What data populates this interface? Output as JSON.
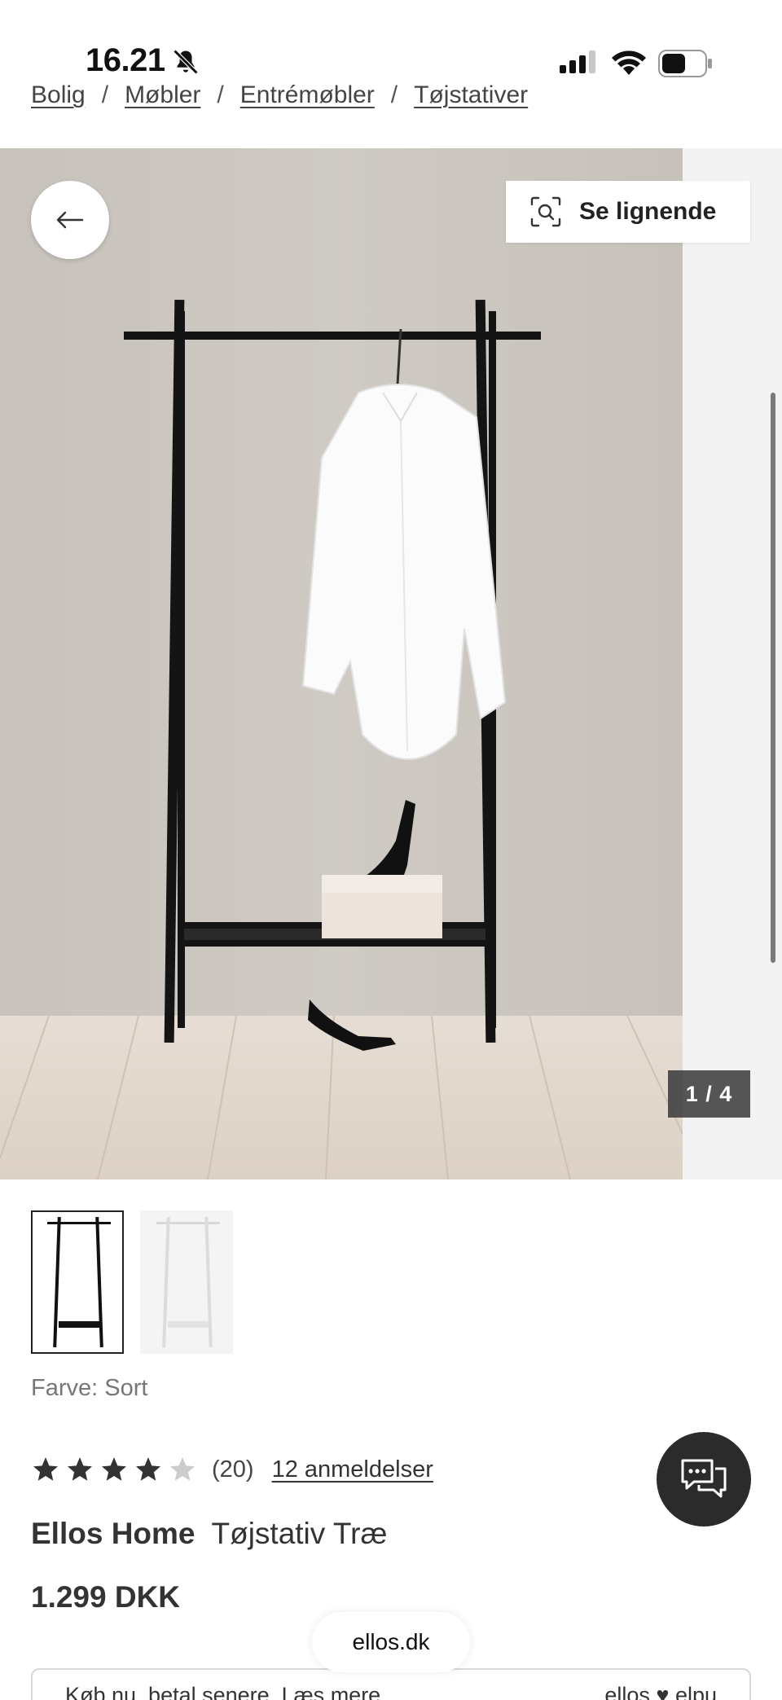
{
  "status_bar": {
    "time": "16.21"
  },
  "breadcrumb": {
    "items": [
      {
        "label": "Bolig"
      },
      {
        "label": "Møbler"
      },
      {
        "label": "Entrémøbler"
      },
      {
        "label": "Tøjstativer"
      }
    ],
    "separator": "/"
  },
  "gallery": {
    "similar_label": "Se lignende",
    "pager": "1 / 4"
  },
  "product": {
    "color_label": "Farve: Sort",
    "rating": {
      "stars": 4,
      "max": 5,
      "count": "(20)",
      "reviews_link": "12 anmeldelser"
    },
    "brand": "Ellos Home",
    "name": "Tøjstativ Træ",
    "price": "1.299 DKK"
  },
  "payment": {
    "text": "Køb nu, betal senere. Læs mere",
    "logo": "ellos ♥ elpu"
  },
  "browser": {
    "url": "ellos.dk"
  },
  "colors": {
    "accent_dark": "#2b2b2b",
    "star_filled": "#333333",
    "star_empty": "#cccccc"
  }
}
